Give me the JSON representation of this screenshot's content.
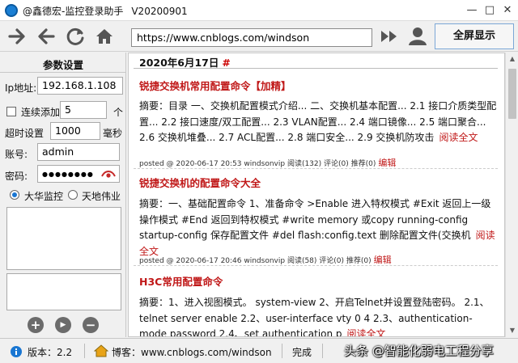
{
  "window": {
    "title": "@鑫德宏-监控登录助手",
    "version": "V20200901"
  },
  "toolbar": {
    "url": "https://www.cnblogs.com/windson",
    "fullscreen_label": "全屏显示"
  },
  "settings": {
    "title": "参数设置",
    "ip_label": "Ip地址:",
    "ip_value": "192.168.1.108",
    "continuous_add_label": "连续添加",
    "continuous_add_value": "5",
    "continuous_add_unit": "个",
    "timeout_label": "超时设置",
    "timeout_value": "1000",
    "timeout_unit": "毫秒",
    "account_label": "账号:",
    "account_value": "admin",
    "password_label": "密码:",
    "password_value": "●●●●●●●●",
    "radio_dahua": "大华监控",
    "radio_tiandi": "天地伟业"
  },
  "content": {
    "date": "2020年6月17日",
    "date_hash": "#",
    "posts": [
      {
        "title": "锐捷交换机常用配置命令【加精】",
        "summary": "摘要：目录 一、交换机配置模式介绍... 二、交换机基本配置... 2.1 接口介质类型配置... 2.2 接口速度/双工配置... 2.3 VLAN配置... 2.4 端口镜像... 2.5 端口聚合... 2.6 交换机堆叠... 2.7 ACL配置... 2.8 端口安全... 2.9 交换机防攻击",
        "read_more": "阅读全文",
        "meta": "posted @ 2020-06-17 20:53 windsonvip 阅读(132) 评论(0) 推荐(0)",
        "edit": "编辑"
      },
      {
        "title": "锐捷交换机的配置命令大全",
        "summary": "摘要：一、基础配置命令 1、准备命令 >Enable 进入特权模式 #Exit 返回上一级操作模式 #End 返回到特权模式 #write memory 或copy running-config startup-config 保存配置文件 #del flash:config.text 删除配置文件(交换机",
        "read_more": "阅读全文",
        "meta": "posted @ 2020-06-17 20:46 windsonvip 阅读(58) 评论(0) 推荐(0)",
        "edit": "编辑"
      },
      {
        "title": "H3C常用配置命令",
        "summary": "摘要：1、进入视图模式。 system-view 2、开启Telnet并设置登陆密码。 2.1、telnet server enable 2.2、user-interface vty 0 4 2.3、authentication-mode password 2.4、set authentication p",
        "read_more": "阅读全文"
      }
    ]
  },
  "status": {
    "version_label": "版本：2.2",
    "blog_label": "博客：www.cnblogs.com/windson",
    "done_label": "完成",
    "watermark": "头条 @智能化弱电工程分享"
  }
}
